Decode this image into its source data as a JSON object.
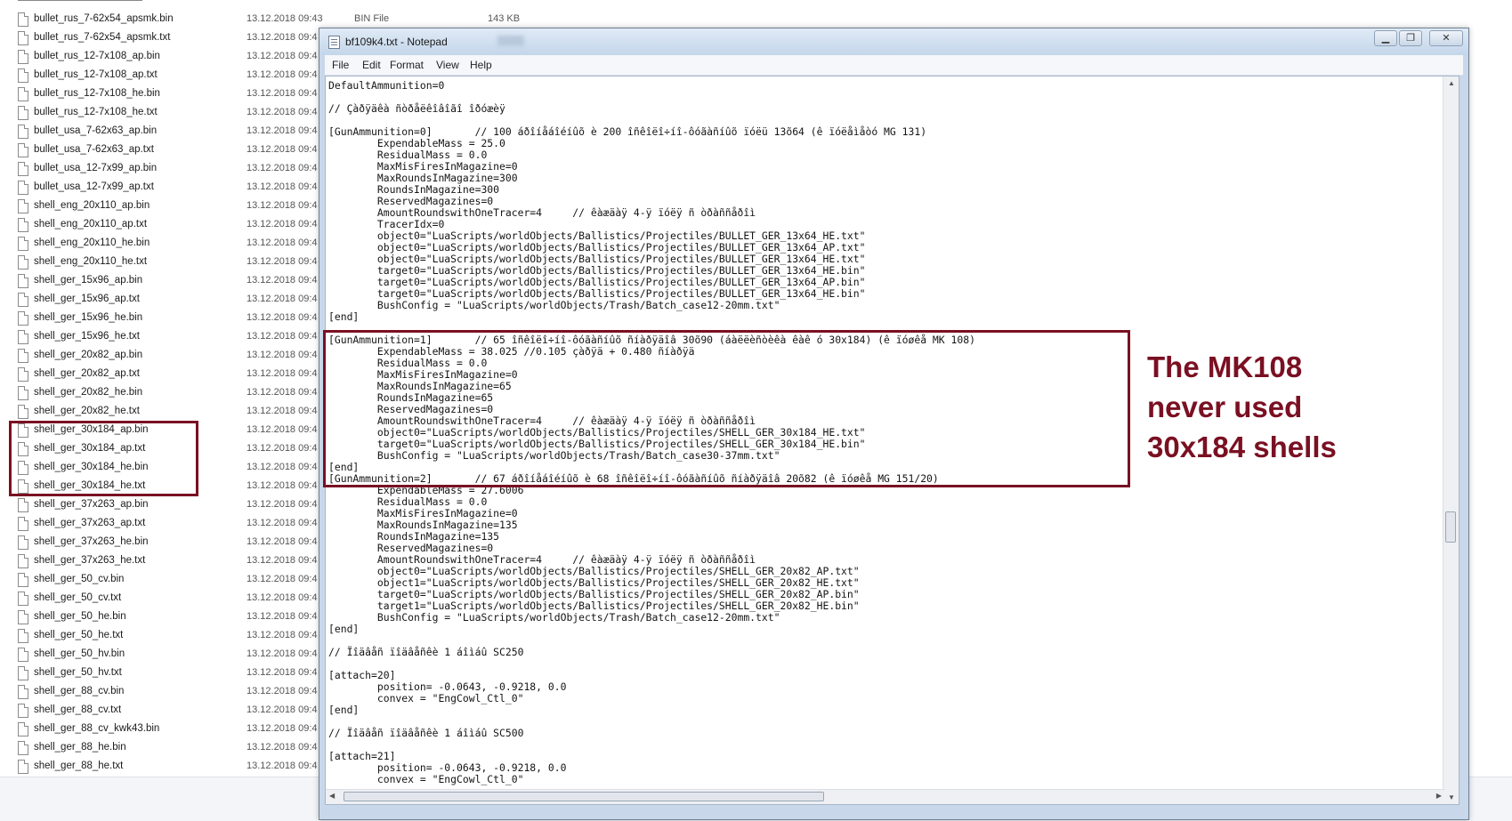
{
  "explorer": {
    "first_row": {
      "name": "bullet_rus_7-62x54_apsmk.bin",
      "date": "13.12.2018 09:43",
      "type": "BIN File",
      "size": "143 KB"
    },
    "rows": [
      {
        "name": "bullet_rus_7-62x54_apsmk.txt",
        "date": "13.12.2018 09:4"
      },
      {
        "name": "bullet_rus_12-7x108_ap.bin",
        "date": "13.12.2018 09:4"
      },
      {
        "name": "bullet_rus_12-7x108_ap.txt",
        "date": "13.12.2018 09:4"
      },
      {
        "name": "bullet_rus_12-7x108_he.bin",
        "date": "13.12.2018 09:4"
      },
      {
        "name": "bullet_rus_12-7x108_he.txt",
        "date": "13.12.2018 09:4"
      },
      {
        "name": "bullet_usa_7-62x63_ap.bin",
        "date": "13.12.2018 09:4"
      },
      {
        "name": "bullet_usa_7-62x63_ap.txt",
        "date": "13.12.2018 09:4"
      },
      {
        "name": "bullet_usa_12-7x99_ap.bin",
        "date": "13.12.2018 09:4"
      },
      {
        "name": "bullet_usa_12-7x99_ap.txt",
        "date": "13.12.2018 09:4"
      },
      {
        "name": "shell_eng_20x110_ap.bin",
        "date": "13.12.2018 09:4"
      },
      {
        "name": "shell_eng_20x110_ap.txt",
        "date": "13.12.2018 09:4"
      },
      {
        "name": "shell_eng_20x110_he.bin",
        "date": "13.12.2018 09:4"
      },
      {
        "name": "shell_eng_20x110_he.txt",
        "date": "13.12.2018 09:4"
      },
      {
        "name": "shell_ger_15x96_ap.bin",
        "date": "13.12.2018 09:4"
      },
      {
        "name": "shell_ger_15x96_ap.txt",
        "date": "13.12.2018 09:4"
      },
      {
        "name": "shell_ger_15x96_he.bin",
        "date": "13.12.2018 09:4"
      },
      {
        "name": "shell_ger_15x96_he.txt",
        "date": "13.12.2018 09:4"
      },
      {
        "name": "shell_ger_20x82_ap.bin",
        "date": "13.12.2018 09:4"
      },
      {
        "name": "shell_ger_20x82_ap.txt",
        "date": "13.12.2018 09:4"
      },
      {
        "name": "shell_ger_20x82_he.bin",
        "date": "13.12.2018 09:4"
      },
      {
        "name": "shell_ger_20x82_he.txt",
        "date": "13.12.2018 09:4"
      },
      {
        "name": "shell_ger_30x184_ap.bin",
        "date": "13.12.2018 09:4"
      },
      {
        "name": "shell_ger_30x184_ap.txt",
        "date": "13.12.2018 09:4"
      },
      {
        "name": "shell_ger_30x184_he.bin",
        "date": "13.12.2018 09:4"
      },
      {
        "name": "shell_ger_30x184_he.txt",
        "date": "13.12.2018 09:4"
      },
      {
        "name": "shell_ger_37x263_ap.bin",
        "date": "13.12.2018 09:4"
      },
      {
        "name": "shell_ger_37x263_ap.txt",
        "date": "13.12.2018 09:4"
      },
      {
        "name": "shell_ger_37x263_he.bin",
        "date": "13.12.2018 09:4"
      },
      {
        "name": "shell_ger_37x263_he.txt",
        "date": "13.12.2018 09:4"
      },
      {
        "name": "shell_ger_50_cv.bin",
        "date": "13.12.2018 09:4"
      },
      {
        "name": "shell_ger_50_cv.txt",
        "date": "13.12.2018 09:4"
      },
      {
        "name": "shell_ger_50_he.bin",
        "date": "13.12.2018 09:4"
      },
      {
        "name": "shell_ger_50_he.txt",
        "date": "13.12.2018 09:4"
      },
      {
        "name": "shell_ger_50_hv.bin",
        "date": "13.12.2018 09:4"
      },
      {
        "name": "shell_ger_50_hv.txt",
        "date": "13.12.2018 09:4"
      },
      {
        "name": "shell_ger_88_cv.bin",
        "date": "13.12.2018 09:4"
      },
      {
        "name": "shell_ger_88_cv.txt",
        "date": "13.12.2018 09:4"
      },
      {
        "name": "shell_ger_88_cv_kwk43.bin",
        "date": "13.12.2018 09:4"
      },
      {
        "name": "shell_ger_88_he.bin",
        "date": "13.12.2018 09:4"
      },
      {
        "name": "shell_ger_88_he.txt",
        "date": "13.12.2018 09:4"
      }
    ]
  },
  "notepad": {
    "title": "bf109k4.txt - Notepad",
    "menu": [
      "File",
      "Edit",
      "Format",
      "View",
      "Help"
    ],
    "content": "DefaultAmmunition=0\n\n// Çàðÿäêà ñòðåëêîâîãî îðóæèÿ\n\n[GunAmmunition=0]       // 100 áðîíåáîéíûõ è 200 îñêîëî÷íî-ôóãàñíûõ ïóëü 13õ64 (ê ïóëåìåòó MG 131)\n        ExpendableMass = 25.0\n        ResidualMass = 0.0\n        MaxMisFiresInMagazine=0\n        MaxRoundsInMagazine=300\n        RoundsInMagazine=300\n        ReservedMagazines=0\n        AmountRoundswithOneTracer=4     // êàæäàÿ 4-ÿ ïóëÿ ñ òðàññåðîì\n        TracerIdx=0\n        object0=\"LuaScripts/worldObjects/Ballistics/Projectiles/BULLET_GER_13x64_HE.txt\"\n        object0=\"LuaScripts/worldObjects/Ballistics/Projectiles/BULLET_GER_13x64_AP.txt\"\n        object0=\"LuaScripts/worldObjects/Ballistics/Projectiles/BULLET_GER_13x64_HE.txt\"\n        target0=\"LuaScripts/worldObjects/Ballistics/Projectiles/BULLET_GER_13x64_HE.bin\"\n        target0=\"LuaScripts/worldObjects/Ballistics/Projectiles/BULLET_GER_13x64_AP.bin\"\n        target0=\"LuaScripts/worldObjects/Ballistics/Projectiles/BULLET_GER_13x64_HE.bin\"\n        BushConfig = \"LuaScripts/worldObjects/Trash/Batch_case12-20mm.txt\"\n[end]\n\n[GunAmmunition=1]       // 65 îñêîëî÷íî-ôóãàñíûõ ñíàðÿäîâ 30õ90 (áàëëèñòèêà êàê ó 30x184) (ê ïóøêå MK 108)\n        ExpendableMass = 38.025 //0.105 çàðÿä + 0.480 ñíàðÿä\n        ResidualMass = 0.0\n        MaxMisFiresInMagazine=0\n        MaxRoundsInMagazine=65\n        RoundsInMagazine=65\n        ReservedMagazines=0\n        AmountRoundswithOneTracer=4     // êàæäàÿ 4-ÿ ïóëÿ ñ òðàññåðîì\n        object0=\"LuaScripts/worldObjects/Ballistics/Projectiles/SHELL_GER_30x184_HE.txt\"\n        target0=\"LuaScripts/worldObjects/Ballistics/Projectiles/SHELL_GER_30x184_HE.bin\"\n        BushConfig = \"LuaScripts/worldObjects/Trash/Batch_case30-37mm.txt\"\n[end]\n[GunAmmunition=2]       // 67 áðîíåáîéíûõ è 68 îñêîëî÷íî-ôóãàñíûõ ñíàðÿäîâ 20õ82 (ê ïóøêå MG 151/20)\n        ExpendableMass = 27.6006\n        ResidualMass = 0.0\n        MaxMisFiresInMagazine=0\n        MaxRoundsInMagazine=135\n        RoundsInMagazine=135\n        ReservedMagazines=0\n        AmountRoundswithOneTracer=4     // êàæäàÿ 4-ÿ ïóëÿ ñ òðàññåðîì\n        object0=\"LuaScripts/worldObjects/Ballistics/Projectiles/SHELL_GER_20x82_AP.txt\"\n        object1=\"LuaScripts/worldObjects/Ballistics/Projectiles/SHELL_GER_20x82_HE.txt\"\n        target0=\"LuaScripts/worldObjects/Ballistics/Projectiles/SHELL_GER_20x82_AP.bin\"\n        target1=\"LuaScripts/worldObjects/Ballistics/Projectiles/SHELL_GER_20x82_HE.bin\"\n        BushConfig = \"LuaScripts/worldObjects/Trash/Batch_case12-20mm.txt\"\n[end]\n\n// Ïîäâåñ ïîäâåñêè 1 áîìáû SC250\n\n[attach=20]\n        position= -0.0643, -0.9218, 0.0\n        convex = \"EngCowl_Ctl_0\"\n[end]\n\n// Ïîäâåñ ïîäâåñêè 1 áîìáû SC500\n\n[attach=21]\n        position= -0.0643, -0.9218, 0.0\n        convex = \"EngCowl_Ctl_0\""
  },
  "annotation": {
    "line1": "The MK108",
    "line2": "never used",
    "line3": "30x184 shells",
    "color": "#7a1022"
  }
}
